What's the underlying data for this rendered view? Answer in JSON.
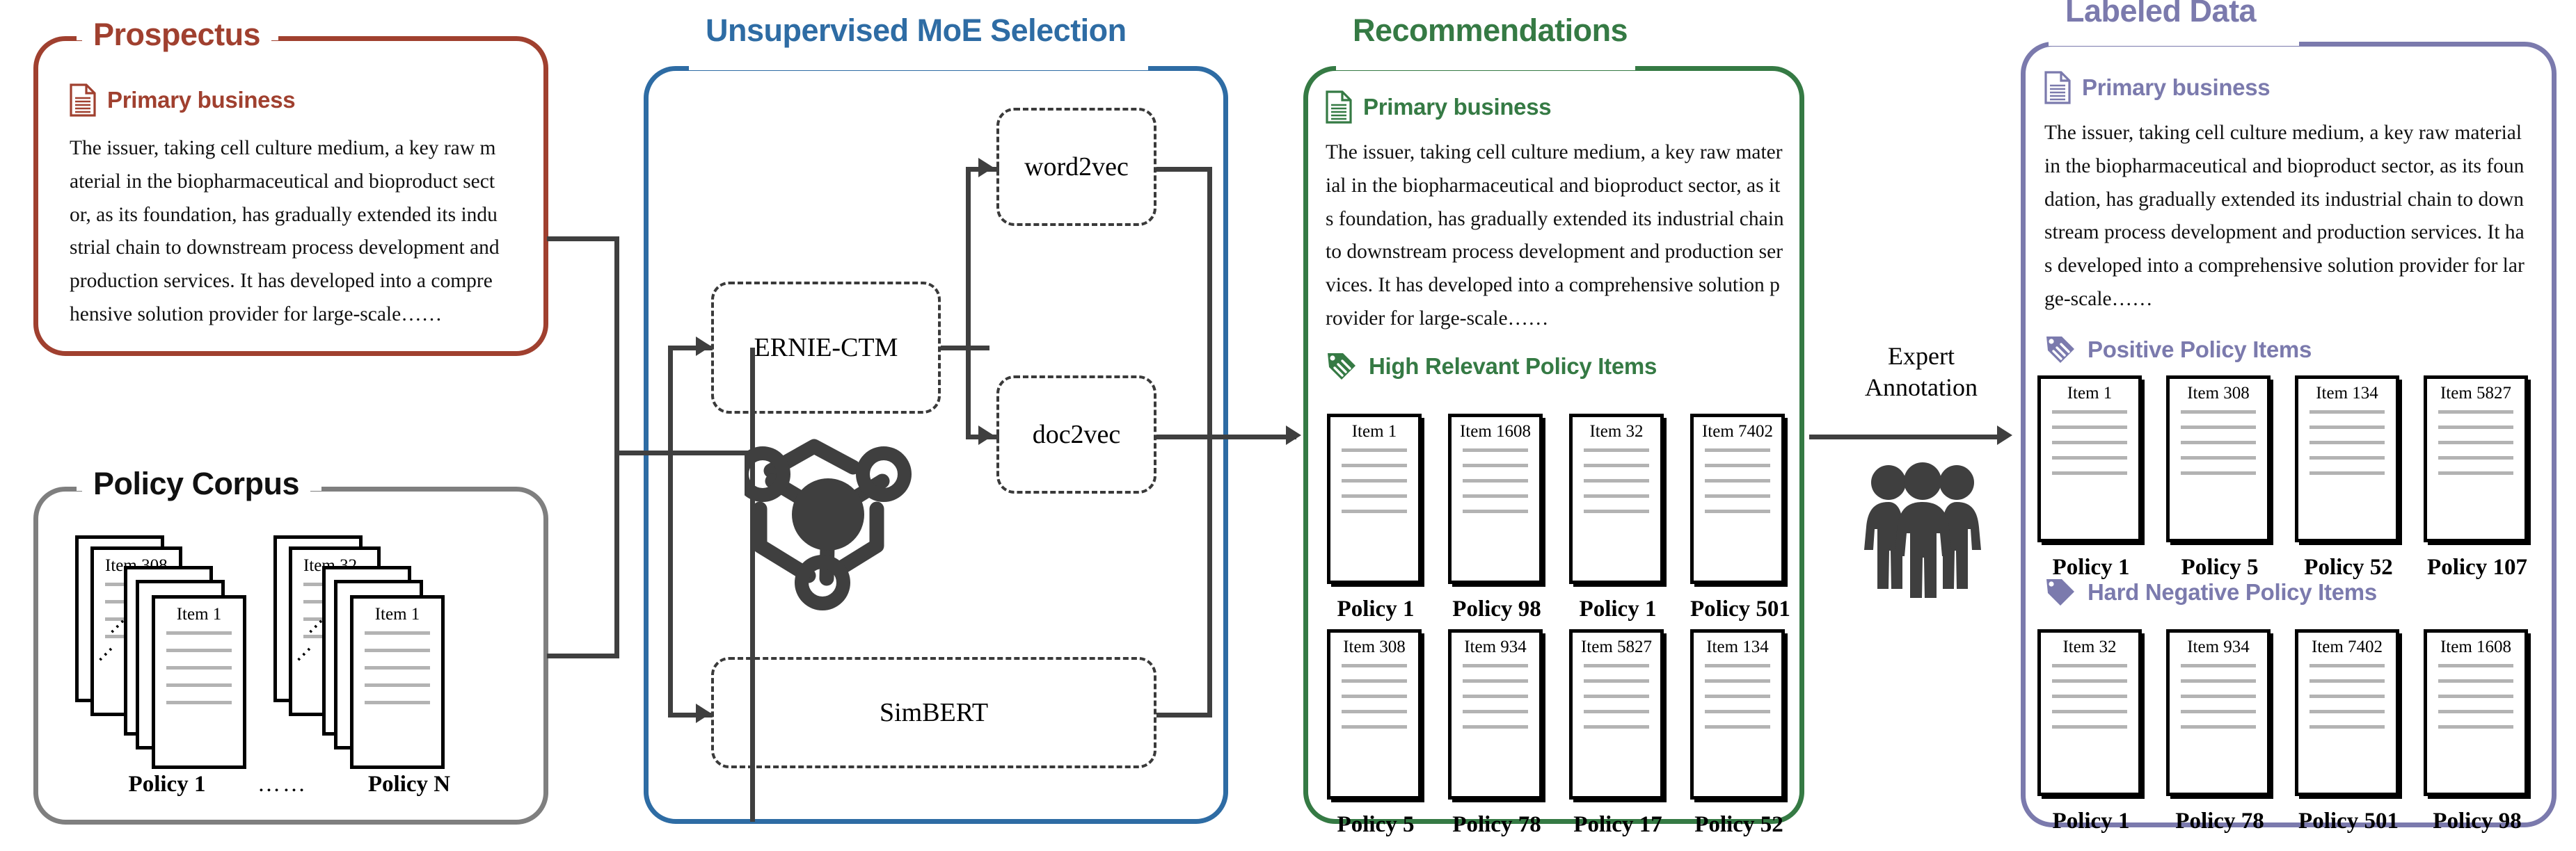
{
  "colors": {
    "prospectus": "#a0402f",
    "corpus": "#7f7f7f",
    "moe": "#2e6ca4",
    "recommendations": "#357a44",
    "labeled": "#7b7aad",
    "connector": "#3f3f3f",
    "rule": "#b3b3b3"
  },
  "prospectus": {
    "title": "Prospectus",
    "section_label": "Primary business",
    "body": "The issuer, taking cell culture medium, a key raw material in the biopharmaceutical and bioproduct sector, as its foundation, has gradually extended its industrial chain to downstream process development and production services. It has developed into a comprehensive solution provider for large-scale……"
  },
  "corpus": {
    "title": "Policy Corpus",
    "groups": [
      {
        "top_item": "Item 308",
        "front_item": "Item 1",
        "label": "Policy 1"
      },
      {
        "top_item": "Item 32",
        "front_item": "Item 1",
        "label": "Policy N"
      }
    ],
    "ellipsis": "……"
  },
  "moe": {
    "title": "Unsupervised MoE Selection",
    "experts": [
      "ERNIE-CTM",
      "word2vec",
      "doc2vec",
      "SimBERT"
    ],
    "icon": "moe-network-icon"
  },
  "recommendations": {
    "title": "Recommendations",
    "section_label": "Primary business",
    "body": "The issuer, taking cell culture medium, a key raw material in the biopharmaceutical and bioproduct sector, as its foundation, has gradually extended its industrial chain to downstream process development and production services. It has developed into a comprehensive solution provider for large-scale……",
    "items_label": "High Relevant Policy Items",
    "row1": [
      {
        "item": "Item 1",
        "policy": "Policy 1"
      },
      {
        "item": "Item 1608",
        "policy": "Policy 98"
      },
      {
        "item": "Item 32",
        "policy": "Policy 1"
      },
      {
        "item": "Item 7402",
        "policy": "Policy 501"
      }
    ],
    "row2": [
      {
        "item": "Item 308",
        "policy": "Policy 5"
      },
      {
        "item": "Item 934",
        "policy": "Policy 78"
      },
      {
        "item": "Item 5827",
        "policy": "Policy 17"
      },
      {
        "item": "Item 134",
        "policy": "Policy 52"
      }
    ]
  },
  "expert_annotation": {
    "line1": "Expert",
    "line2": "Annotation",
    "icon": "three-people-icon"
  },
  "labeled": {
    "title": "Labeled Data",
    "section_label": "Primary business",
    "body": "The issuer, taking cell culture medium, a key raw material in the biopharmaceutical and bioproduct sector, as its foundation, has gradually extended its industrial chain to downstream process development and production services. It has developed into a comprehensive solution provider for large-scale……",
    "positive_label": "Positive Policy Items",
    "negative_label": "Hard Negative Policy Items",
    "positive": [
      {
        "item": "Item 1",
        "policy": "Policy 1"
      },
      {
        "item": "Item 308",
        "policy": "Policy 5"
      },
      {
        "item": "Item 134",
        "policy": "Policy 52"
      },
      {
        "item": "Item 5827",
        "policy": "Policy 107"
      }
    ],
    "negative": [
      {
        "item": "Item 32",
        "policy": "Policy 1"
      },
      {
        "item": "Item 934",
        "policy": "Policy 78"
      },
      {
        "item": "Item 7402",
        "policy": "Policy 501"
      },
      {
        "item": "Item 1608",
        "policy": "Policy 98"
      }
    ]
  }
}
